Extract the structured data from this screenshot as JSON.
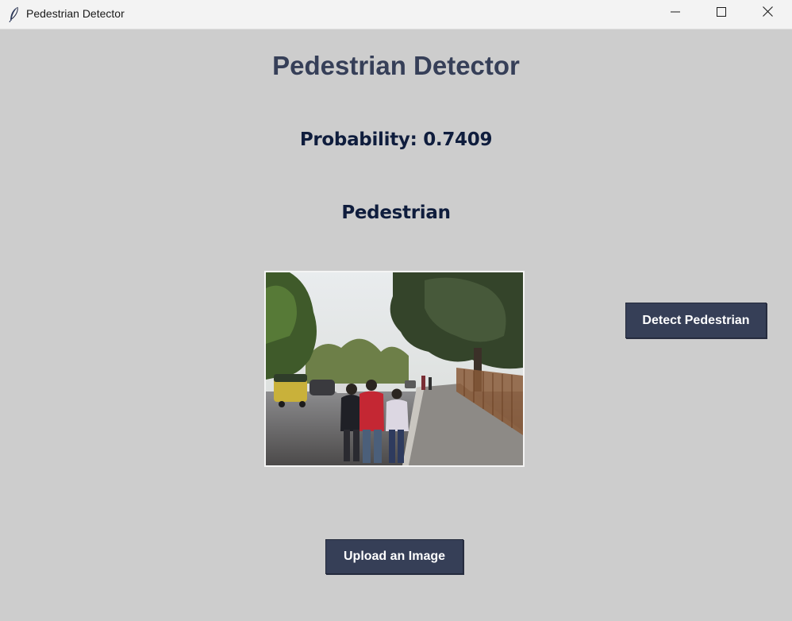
{
  "window": {
    "title": "Pedestrian Detector",
    "icons": {
      "app": "feather-icon",
      "minimize": "minimize-icon",
      "maximize": "maximize-icon",
      "close": "close-icon"
    }
  },
  "main": {
    "heading": "Pedestrian Detector",
    "probability_text": "Probability: 0.7409",
    "result_text": "Pedestrian"
  },
  "buttons": {
    "detect_label": "Detect Pedestrian",
    "upload_label": "Upload an Image"
  },
  "colors": {
    "background": "#cdcdcd",
    "heading": "#363f58",
    "text": "#0f1d3d",
    "button": "#363f57",
    "button_text": "#ffffff"
  }
}
